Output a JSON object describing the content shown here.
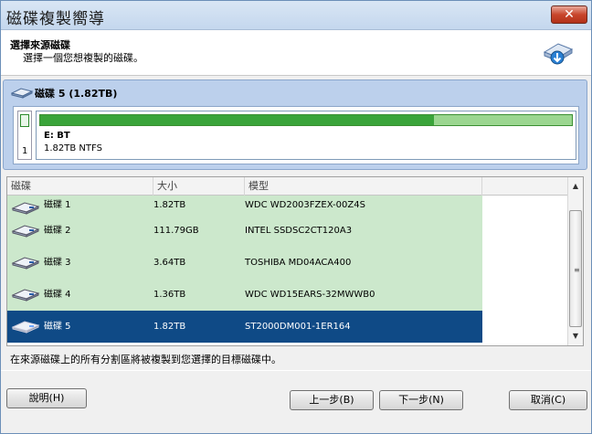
{
  "window": {
    "title": "磁碟複製嚮導",
    "close_label": "✕"
  },
  "header": {
    "title": "選擇來源磁碟",
    "subtitle": "選擇一個您想複製的磁碟。"
  },
  "source": {
    "title": "磁碟 5 (1.82TB)",
    "index": "1",
    "partition_label": "E: BT",
    "partition_size": "1.82TB NTFS",
    "used_fraction": 0.74
  },
  "table": {
    "columns": [
      "磁碟",
      "大小",
      "模型"
    ],
    "rows": [
      {
        "name": "磁碟 1",
        "size": "1.82TB",
        "model": "WDC WD2003FZEX-00Z4S"
      },
      {
        "name": "磁碟 2",
        "size": "111.79GB",
        "model": "INTEL SSDSC2CT120A3"
      },
      {
        "name": "磁碟 3",
        "size": "3.64TB",
        "model": "TOSHIBA MD04ACA400"
      },
      {
        "name": "磁碟 4",
        "size": "1.36TB",
        "model": "WDC WD15EARS-32MWWB0"
      },
      {
        "name": "磁碟 5",
        "size": "1.82TB",
        "model": "ST2000DM001-1ER164"
      }
    ],
    "selected_index": 4
  },
  "info_text": "在來源磁碟上的所有分割區將被複製到您選擇的目標磁碟中。",
  "buttons": {
    "help": "說明(H)",
    "back": "上一步(B)",
    "next": "下一步(N)",
    "cancel": "取消(C)"
  },
  "colors": {
    "selected_row": "#0f4a86",
    "row_bg": "#cce8cc",
    "partition_used": "#3aa43a",
    "partition_free": "#9bd690"
  }
}
